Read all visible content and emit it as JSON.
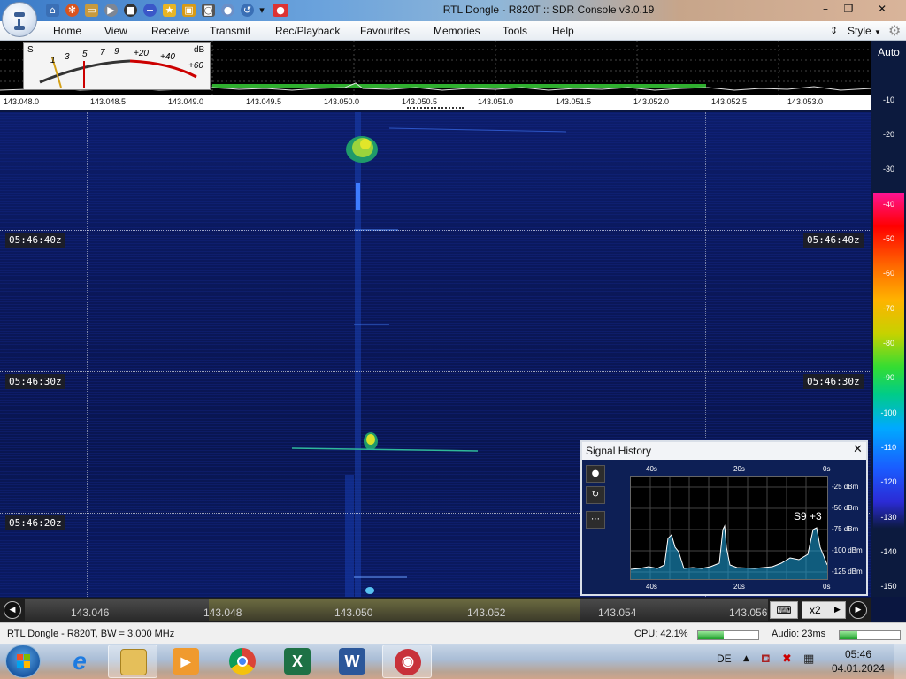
{
  "window": {
    "title": "RTL Dongle - R820T :: SDR Console v3.0.19",
    "controls": {
      "minimize": "–",
      "maximize": "❐",
      "close": "✕"
    }
  },
  "quick_access": [
    "home-icon",
    "settings-icon",
    "folder-icon",
    "play-icon",
    "stop-icon",
    "add-icon",
    "star-icon",
    "lock-icon",
    "camera-icon",
    "drop-icon",
    "undo-icon",
    "record-icon",
    "dropdown-icon"
  ],
  "menu": {
    "items": [
      "Home",
      "View",
      "Receive",
      "Transmit",
      "Rec/Playback",
      "Favourites",
      "Memories",
      "Tools",
      "Help"
    ],
    "style_label": "Style"
  },
  "smeter": {
    "s_label": "S",
    "db_label": "dB",
    "scale_s": [
      "1",
      "3",
      "5",
      "7",
      "9"
    ],
    "scale_db": [
      "+20",
      "+40",
      "+60"
    ]
  },
  "auto_label": "Auto",
  "freq_axis": [
    "143.048.0",
    "143.048.5",
    "143.049.0",
    "143.049.5",
    "143.050.0",
    "143.050.5",
    "143.051.0",
    "143.051.5",
    "143.052.0",
    "143.052.5",
    "143.053.0"
  ],
  "db_scale": [
    "-10",
    "-20",
    "-30",
    "-40",
    "-50",
    "-60",
    "-70",
    "-80",
    "-90",
    "-100",
    "-110",
    "-120",
    "-130",
    "-140",
    "-150"
  ],
  "db_scale_colors": [
    "#ff1493",
    "#ff0000",
    "#ff4500",
    "#ff8c00",
    "#c6d200",
    "#33dd33",
    "#00cc88",
    "#00aaff",
    "#1a5cff",
    "#2b2bd6"
  ],
  "timestamps": [
    "05:46:40z",
    "05:46:30z",
    "05:46:20z"
  ],
  "signal_history": {
    "title": "Signal History",
    "close": "✕",
    "time_top": [
      "40s",
      "20s",
      "0s"
    ],
    "time_bottom": [
      "40s",
      "20s",
      "0s"
    ],
    "levels": [
      "-25 dBm",
      "-50 dBm",
      "-75 dBm",
      "-100 dBm",
      "-125 dBm"
    ],
    "s_reading": "S9 +3",
    "side_buttons": [
      "●",
      "↻",
      "⋯"
    ]
  },
  "bottom_freqs": [
    "143.046",
    "143.048",
    "143.050",
    "143.052",
    "143.054",
    "143.056"
  ],
  "bottom_controls": {
    "keyboard": "⌨",
    "zoom": "x2",
    "next": "▶"
  },
  "status": {
    "device": "RTL Dongle - R820T, BW = 3.000 MHz",
    "cpu": "CPU: 42.1%",
    "cpu_value": 42.1,
    "audio": "Audio: 23ms"
  },
  "taskbar": {
    "apps": [
      "start",
      "internet-explorer",
      "file-explorer",
      "media-player",
      "chrome",
      "excel",
      "word",
      "sdr-console"
    ],
    "language": "DE",
    "time": "05:46",
    "date": "04.01.2024"
  }
}
